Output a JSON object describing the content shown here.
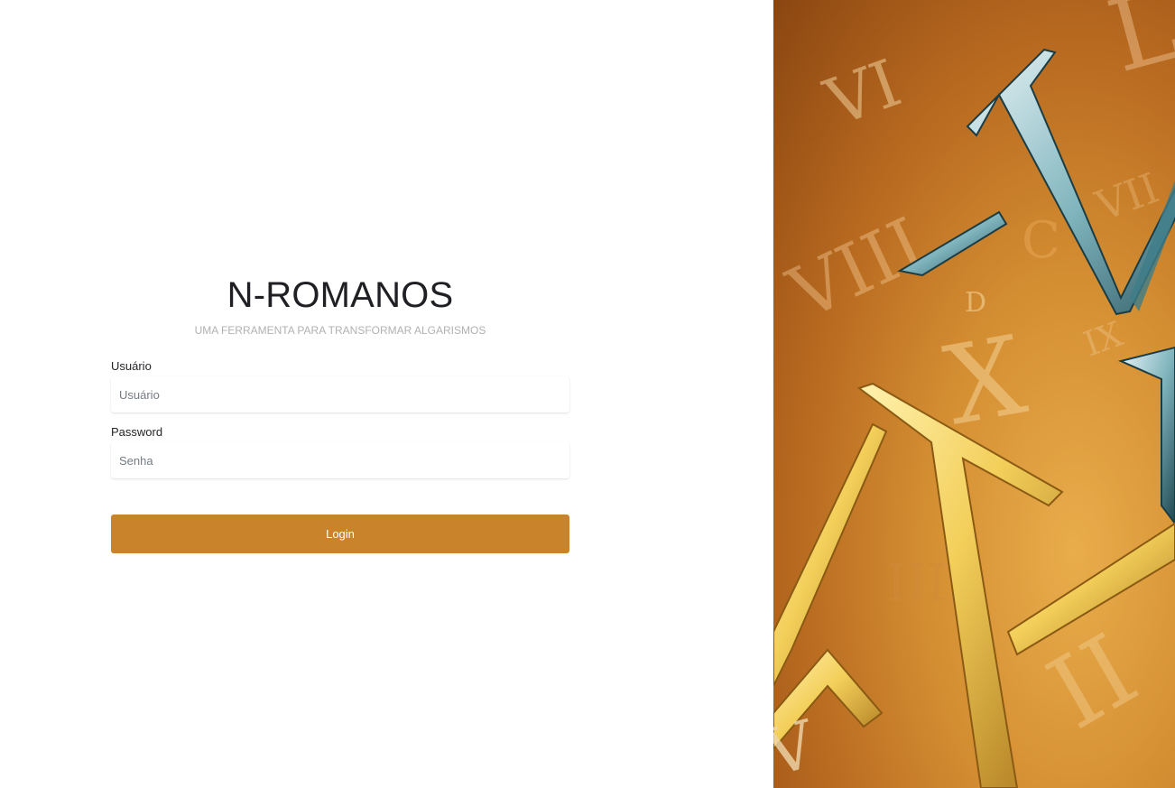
{
  "app": {
    "title": "N-ROMANOS",
    "subtitle": "UMA FERRAMENTA PARA TRANSFORMAR ALGARISMOS"
  },
  "form": {
    "username_label": "Usuário",
    "username_placeholder": "Usuário",
    "username_value": "",
    "password_label": "Password",
    "password_placeholder": "Senha",
    "password_value": "",
    "login_label": "Login"
  },
  "hero": {
    "numerals": [
      "VI",
      "L",
      "VII",
      "C",
      "D",
      "VIII",
      "X",
      "IX",
      "III",
      "II",
      "V",
      "X"
    ]
  },
  "colors": {
    "accent": "#c8832b",
    "title": "#1f1f24",
    "subtitle": "#b1b1b1"
  }
}
